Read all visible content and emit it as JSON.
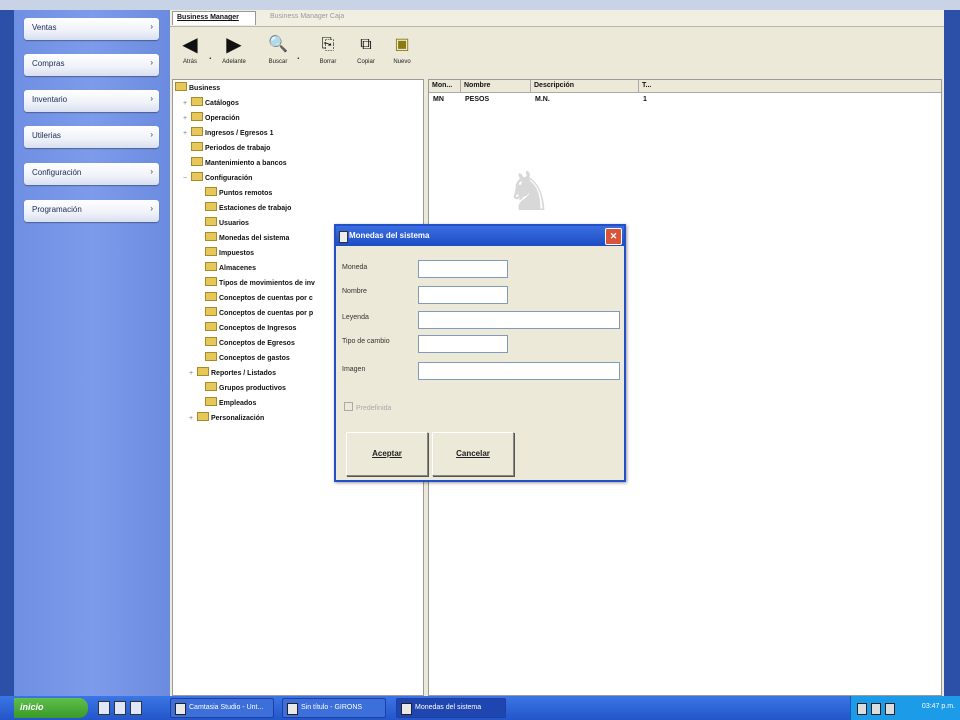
{
  "sidebar": {
    "items": [
      {
        "label": "Ventas"
      },
      {
        "label": "Compras"
      },
      {
        "label": "Inventario"
      },
      {
        "label": "Utilerias"
      },
      {
        "label": "Configuración"
      },
      {
        "label": "Programación"
      }
    ],
    "arrow_glyph": "›"
  },
  "tabs": [
    {
      "label": "Business Manager",
      "active": true
    },
    {
      "label": "Business Manager Caja",
      "active": false
    }
  ],
  "toolbar": {
    "items": [
      {
        "label": "Atrás",
        "icon": "back-arrow-icon",
        "glyph": "◀"
      },
      {
        "label": "Adelante",
        "icon": "forward-arrow-icon",
        "glyph": "▶"
      },
      {
        "label": "Buscar",
        "icon": "search-icon",
        "glyph": "🔍"
      },
      {
        "label": "Borrar",
        "icon": "delete-icon",
        "glyph": "⎘"
      },
      {
        "label": "Copiar",
        "icon": "copy-icon",
        "glyph": "⧉"
      },
      {
        "label": "Nuevo",
        "icon": "new-icon",
        "glyph": "▣"
      }
    ]
  },
  "tree": {
    "root": "Business",
    "items": [
      {
        "label": "Catálogos",
        "expander": "+"
      },
      {
        "label": "Operación",
        "expander": "+"
      },
      {
        "label": "Ingresos / Egresos 1",
        "expander": "+"
      },
      {
        "label": "Periodos de trabajo",
        "expander": ""
      },
      {
        "label": "Mantenimiento a bancos",
        "expander": ""
      },
      {
        "label": "Configuración",
        "expander": "−"
      },
      {
        "label": "Puntos remotos",
        "expander": ""
      },
      {
        "label": "Estaciones de trabajo",
        "expander": ""
      },
      {
        "label": "Usuarios",
        "expander": ""
      },
      {
        "label": "Monedas del sistema",
        "expander": ""
      },
      {
        "label": "Impuestos",
        "expander": ""
      },
      {
        "label": "Almacenes",
        "expander": ""
      },
      {
        "label": "Tipos de movimientos de inv",
        "expander": ""
      },
      {
        "label": "Conceptos de cuentas por c",
        "expander": ""
      },
      {
        "label": "Conceptos de cuentas por p",
        "expander": ""
      },
      {
        "label": "Conceptos de Ingresos",
        "expander": ""
      },
      {
        "label": "Conceptos de Egresos",
        "expander": ""
      },
      {
        "label": "Conceptos de gastos",
        "expander": ""
      },
      {
        "label": "Reportes / Listados",
        "expander": "+"
      },
      {
        "label": "Grupos productivos",
        "expander": ""
      },
      {
        "label": "Empleados",
        "expander": ""
      },
      {
        "label": "Personalización",
        "expander": "+"
      }
    ]
  },
  "list": {
    "columns": [
      "Mon...",
      "Nombre",
      "Descripción",
      "T..."
    ],
    "rows": [
      {
        "moneda": "MN",
        "nombre": "PESOS",
        "descripcion": "M.N.",
        "tipo": "1"
      }
    ]
  },
  "dialog": {
    "title": "Monedas del sistema",
    "close_glyph": "✕",
    "fields": [
      {
        "label": "Moneda",
        "value": ""
      },
      {
        "label": "Nombre",
        "value": ""
      },
      {
        "label": "Leyenda",
        "value": ""
      },
      {
        "label": "Tipo de cambio",
        "value": ""
      },
      {
        "label": "Imagen",
        "value": ""
      }
    ],
    "checkbox_label": "Predefinida",
    "accept_label": "Aceptar",
    "cancel_label": "Cancelar"
  },
  "taskbar": {
    "start_label": "inicio",
    "tasks": [
      {
        "label": "Camtasia Studio - Unt..."
      },
      {
        "label": "Sin título - GIRONS"
      },
      {
        "label": "Monedas del sistema"
      }
    ],
    "clock": "03:47 p.m."
  }
}
